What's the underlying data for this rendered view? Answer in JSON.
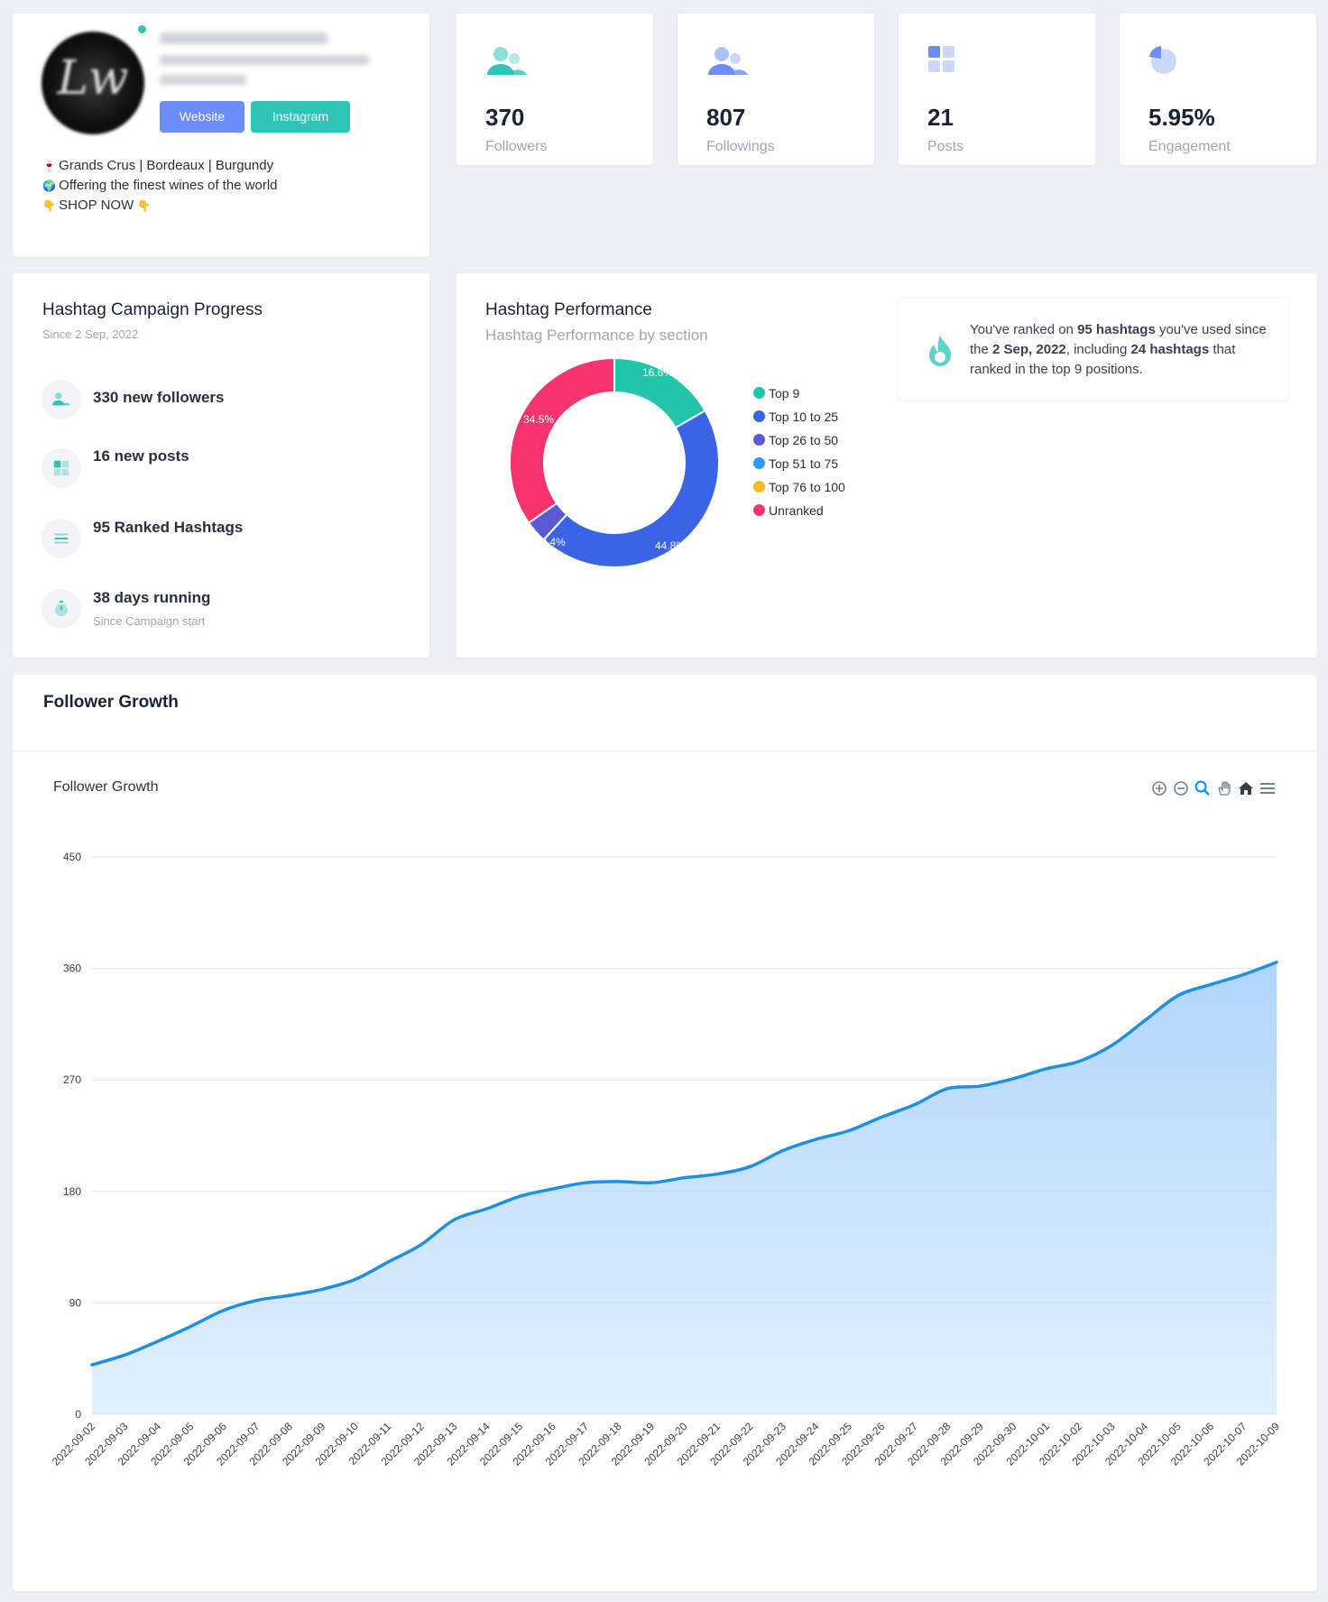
{
  "profile": {
    "website_label": "Website",
    "instagram_label": "Instagram",
    "bio": [
      {
        "icon": "wine-glass-icon",
        "glyph": "🍷",
        "text": "Grands Crus | Bordeaux | Burgundy"
      },
      {
        "icon": "globe-icon",
        "glyph": "🌍",
        "text": "Offering the finest wines of the world"
      },
      {
        "icon": "pointing-down-icon",
        "glyph": "👇",
        "text": "SHOP NOW"
      }
    ]
  },
  "stats": [
    {
      "value": "370",
      "label": "Followers",
      "icon": "followers-icon",
      "color": "#2ec4b6"
    },
    {
      "value": "807",
      "label": "Followings",
      "icon": "followings-icon",
      "color": "#6b8df5"
    },
    {
      "value": "21",
      "label": "Posts",
      "icon": "posts-grid-icon",
      "color": "#6b8df5"
    },
    {
      "value": "5.95%",
      "label": "Engagement",
      "icon": "pie-icon",
      "color": "#6b8df5"
    }
  ],
  "campaign": {
    "title": "Hashtag Campaign Progress",
    "since": "Since 2 Sep, 2022",
    "items": [
      {
        "text": "330 new followers",
        "icon": "followers-icon",
        "sub": ""
      },
      {
        "text": "16 new posts",
        "icon": "posts-grid-icon",
        "sub": ""
      },
      {
        "text": "95 Ranked Hashtags",
        "icon": "list-icon",
        "sub": ""
      },
      {
        "text": "38 days running",
        "icon": "stopwatch-icon",
        "sub": "Since Campaign start"
      }
    ]
  },
  "performance": {
    "title": "Hashtag Performance",
    "subtitle": "Hashtag Performance by section",
    "rank_text": {
      "p1": "You've ranked on ",
      "b1": "95 hashtags",
      "p2": " you've used since the ",
      "b2": "2 Sep, 2022",
      "p3": ", including ",
      "b3": "24 hashtags",
      "p4": " that ranked in the top 9 positions."
    }
  },
  "growth": {
    "card_title": "Follower Growth"
  },
  "chart_data": [
    {
      "type": "pie",
      "title": "",
      "categories": [
        "Top 9",
        "Top 10 to 25",
        "Top 26 to 50",
        "Top 51 to 75",
        "Top 76 to 100",
        "Unranked"
      ],
      "values": [
        16.6,
        44.8,
        3.4,
        0,
        0,
        34.5
      ],
      "labels": [
        "16.6%",
        "44.8%",
        "3.4%",
        "",
        "",
        "34.5%"
      ],
      "colors": [
        "#21c6a9",
        "#3a63e6",
        "#5a59d6",
        "#2a9df4",
        "#f7b924",
        "#f6336f"
      ],
      "legend": "right"
    },
    {
      "type": "area",
      "title": "Follower Growth",
      "xlabel": "",
      "ylabel": "",
      "ylim": [
        0,
        450
      ],
      "yticks": [
        "0",
        "90",
        "180",
        "270",
        "360",
        "450"
      ],
      "grid": true,
      "x": [
        "2022-09-02",
        "2022-09-03",
        "2022-09-04",
        "2022-09-05",
        "2022-09-06",
        "2022-09-07",
        "2022-09-08",
        "2022-09-09",
        "2022-09-10",
        "2022-09-11",
        "2022-09-12",
        "2022-09-13",
        "2022-09-14",
        "2022-09-15",
        "2022-09-16",
        "2022-09-17",
        "2022-09-18",
        "2022-09-19",
        "2022-09-20",
        "2022-09-21",
        "2022-09-22",
        "2022-09-23",
        "2022-09-24",
        "2022-09-25",
        "2022-09-26",
        "2022-09-27",
        "2022-09-28",
        "2022-09-29",
        "2022-09-30",
        "2022-10-01",
        "2022-10-02",
        "2022-10-03",
        "2022-10-04",
        "2022-10-05",
        "2022-10-06",
        "2022-10-07",
        "2022-10-09"
      ],
      "values": [
        40,
        48,
        59,
        71,
        84,
        92,
        96,
        101,
        109,
        123,
        137,
        157,
        166,
        176,
        182,
        187,
        188,
        187,
        191,
        194,
        200,
        213,
        222,
        229,
        240,
        250,
        263,
        265,
        271,
        279,
        285,
        298,
        318,
        338,
        347,
        355,
        365
      ],
      "color": "#1e8fe6"
    }
  ]
}
